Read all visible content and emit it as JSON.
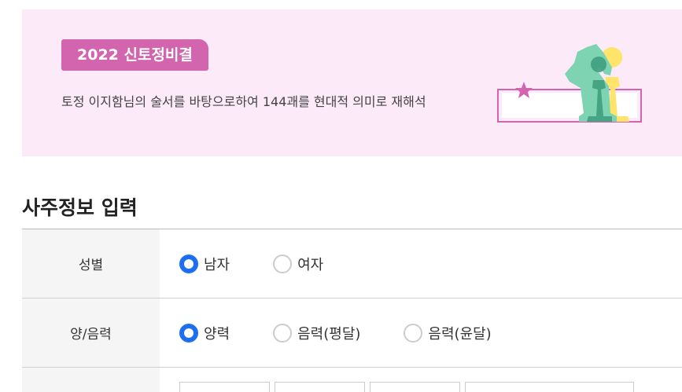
{
  "banner": {
    "badge": "2022 신토정비결",
    "description": "토정 이지함님의 술서를 바탕으로하여 144괘를 현대적 의미로 재해석"
  },
  "section": {
    "title": "사주정보 입력"
  },
  "form": {
    "gender": {
      "label": "성별",
      "options": [
        {
          "label": "남자",
          "selected": true
        },
        {
          "label": "여자",
          "selected": false
        }
      ]
    },
    "calendar": {
      "label": "양/음력",
      "options": [
        {
          "label": "양력",
          "selected": true
        },
        {
          "label": "음력(평달)",
          "selected": false
        },
        {
          "label": "음력(윤달)",
          "selected": false
        }
      ]
    }
  },
  "colors": {
    "banner_bg": "#fdeaf8",
    "badge_bg": "#d265ad",
    "radio_on": "#1e6ff0",
    "label_bg": "#f5f5f5"
  },
  "icons": {
    "illustration": "chess-knight-pawn-illustration"
  }
}
